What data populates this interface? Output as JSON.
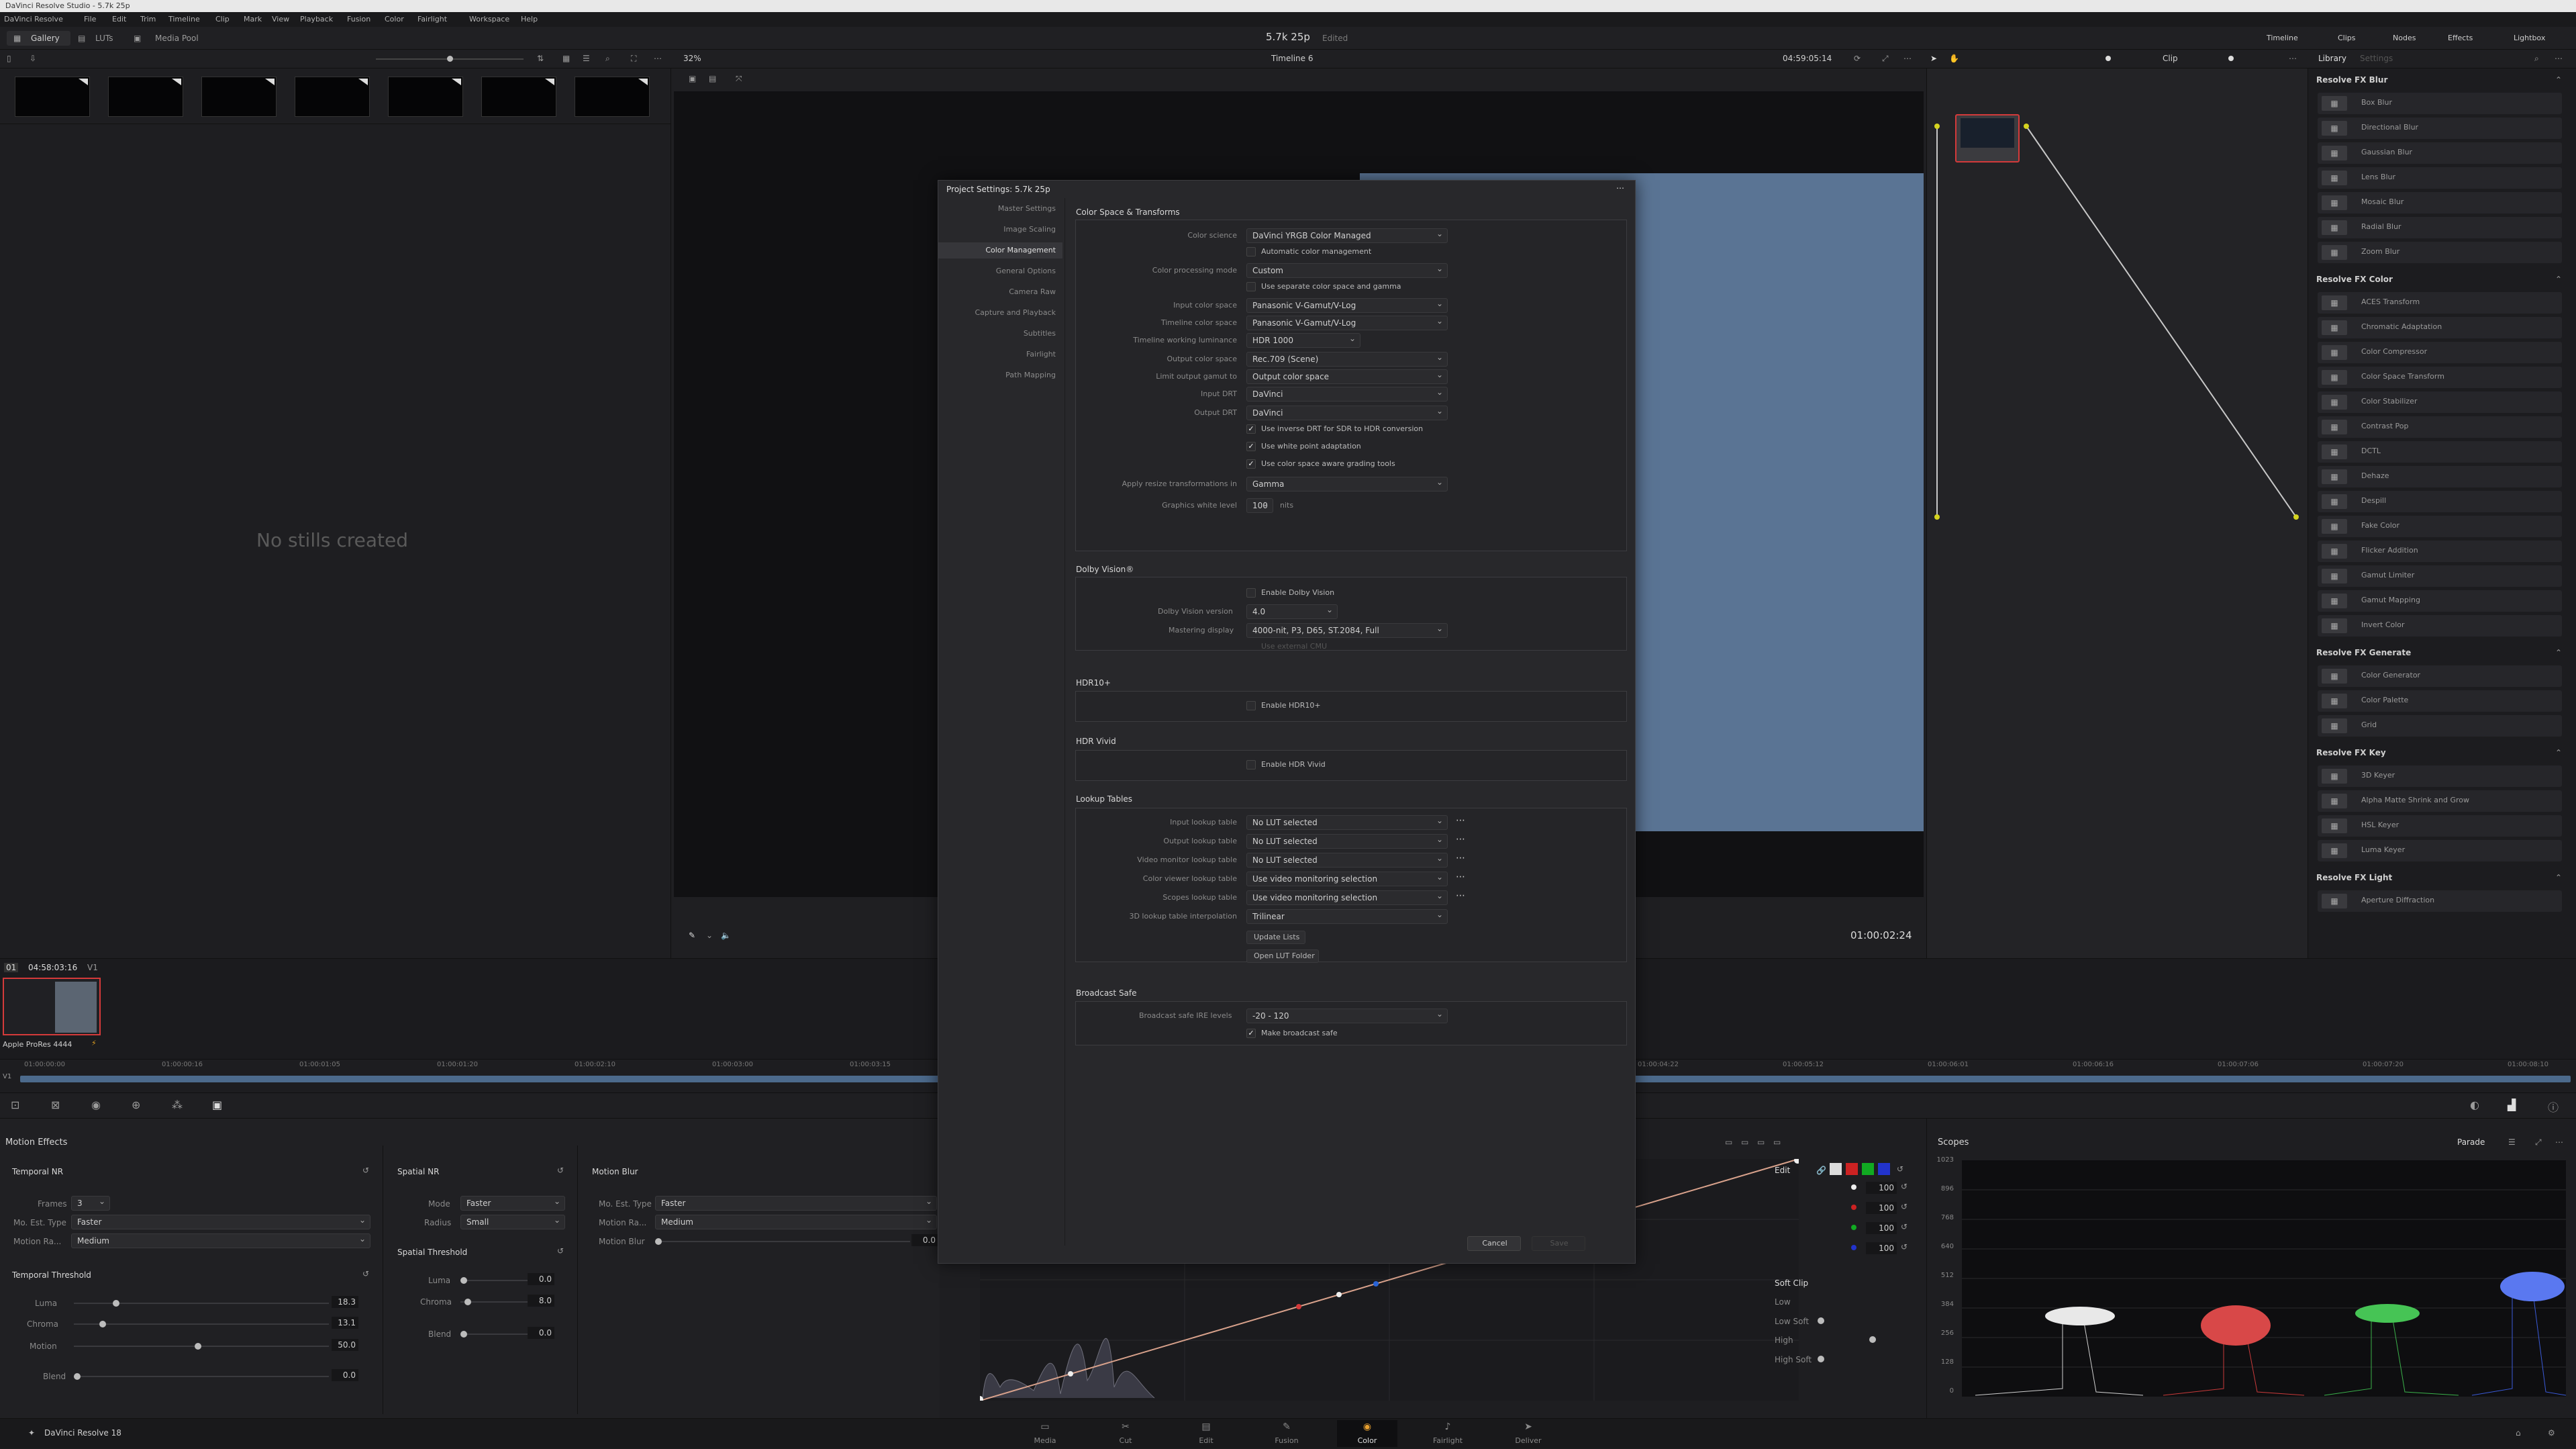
{
  "window_title": "DaVinci Resolve Studio - 5.7k 25p",
  "menu": [
    "DaVinci Resolve",
    "File",
    "Edit",
    "Trim",
    "Timeline",
    "Clip",
    "Mark",
    "View",
    "Playback",
    "Fusion",
    "Color",
    "Fairlight",
    "Workspace",
    "Help"
  ],
  "top": {
    "gallery": "Gallery",
    "luts": "LUTs",
    "media_pool": "Media Pool",
    "project_name": "5.7k 25p",
    "project_status": "Edited",
    "right_tabs": [
      "Timeline",
      "Clips",
      "Nodes",
      "Effects",
      "Lightbox"
    ]
  },
  "viewer_bar": {
    "zoom": "32%",
    "timeline": "Timeline 6",
    "timecode": "04:59:05:14",
    "clip_mode": "Clip",
    "library_tab": "Library",
    "settings_tab": "Settings"
  },
  "gallery": {
    "empty_text": "No stills created"
  },
  "viewer": {
    "timecode": "01:00:02:24"
  },
  "clips": {
    "index": "01",
    "timecode": "04:58:03:16",
    "track": "V1",
    "codec": "Apple ProRes 4444"
  },
  "ruler_labels": [
    "01:00:00:00",
    "01:00:00:16",
    "01:00:01:05",
    "01:00:01:20",
    "01:00:02:10",
    "01:00:03:00",
    "01:00:03:15"
  ],
  "ruler_labels_right": [
    "01:00:04:22",
    "01:00:05:12",
    "01:00:06:01",
    "01:00:06:16",
    "01:00:07:06",
    "01:00:07:20",
    "01:00:08:10"
  ],
  "dialog": {
    "title": "Project Settings:  5.7k 25p",
    "sidebar": [
      "Master Settings",
      "Image Scaling",
      "Color Management",
      "General Options",
      "Camera Raw",
      "Capture and Playback",
      "Subtitles",
      "Fairlight",
      "Path Mapping"
    ],
    "active_index": 2,
    "section_csm": "Color Space & Transforms",
    "rows": [
      {
        "label": "Color science",
        "value": "DaVinci YRGB Color Managed"
      },
      {
        "label": "",
        "check": "Automatic color management",
        "checked": false
      },
      {
        "label": "Color processing mode",
        "value": "Custom"
      },
      {
        "label": "",
        "check": "Use separate color space and gamma",
        "checked": false
      },
      {
        "label": "Input color space",
        "value": "Panasonic V-Gamut/V-Log"
      },
      {
        "label": "Timeline color space",
        "value": "Panasonic V-Gamut/V-Log"
      },
      {
        "label": "Timeline working luminance",
        "value": "HDR 1000"
      },
      {
        "label": "Output color space",
        "value": "Rec.709 (Scene)"
      },
      {
        "label": "Limit output gamut to",
        "value": "Output color space"
      },
      {
        "label": "Input DRT",
        "value": "DaVinci"
      },
      {
        "label": "Output DRT",
        "value": "DaVinci"
      },
      {
        "label": "",
        "check": "Use inverse DRT for SDR to HDR conversion",
        "checked": true
      },
      {
        "label": "",
        "check": "Use white point adaptation",
        "checked": true
      },
      {
        "label": "",
        "check": "Use color space aware grading tools",
        "checked": true
      },
      {
        "label": "Apply resize transformations in",
        "value": "Gamma"
      },
      {
        "label": "Graphics white level",
        "value": "100",
        "unit": "nits"
      }
    ],
    "dolby": {
      "title": "Dolby Vision®",
      "enable": "Enable Dolby Vision",
      "version_label": "Dolby Vision version",
      "version": "4.0",
      "mastering_label": "Mastering display",
      "mastering": "4000-nit, P3, D65, ST.2084, Full",
      "external": "Use external CMU"
    },
    "hdr10": {
      "title": "HDR10+",
      "enable": "Enable HDR10+"
    },
    "hdrvivid": {
      "title": "HDR Vivid",
      "enable": "Enable HDR Vivid"
    },
    "luts": {
      "title": "Lookup Tables",
      "rows": [
        {
          "label": "Input lookup table",
          "value": "No LUT selected"
        },
        {
          "label": "Output lookup table",
          "value": "No LUT selected"
        },
        {
          "label": "Video monitor lookup table",
          "value": "No LUT selected"
        },
        {
          "label": "Color viewer lookup table",
          "value": "Use video monitoring selection"
        },
        {
          "label": "Scopes lookup table",
          "value": "Use video monitoring selection"
        },
        {
          "label": "3D lookup table interpolation",
          "value": "Trilinear"
        }
      ],
      "update": "Update Lists",
      "open": "Open LUT Folder"
    },
    "broadcast": {
      "title": "Broadcast Safe",
      "label": "Broadcast safe IRE levels",
      "value": "-20 - 120",
      "check": "Make broadcast safe"
    },
    "cancel": "Cancel",
    "save": "Save"
  },
  "fx": {
    "groups": [
      {
        "title": "Resolve FX Blur",
        "items": [
          "Box Blur",
          "Directional Blur",
          "Gaussian Blur",
          "Lens Blur",
          "Mosaic Blur",
          "Radial Blur",
          "Zoom Blur"
        ]
      },
      {
        "title": "Resolve FX Color",
        "items": [
          "ACES Transform",
          "Chromatic Adaptation",
          "Color Compressor",
          "Color Space Transform",
          "Color Stabilizer",
          "Contrast Pop",
          "DCTL",
          "Dehaze",
          "Despill",
          "Fake Color",
          "Flicker Addition",
          "Gamut Limiter",
          "Gamut Mapping",
          "Invert Color"
        ]
      },
      {
        "title": "Resolve FX Generate",
        "items": [
          "Color Generator",
          "Color Palette",
          "Grid"
        ]
      },
      {
        "title": "Resolve FX Key",
        "items": [
          "3D Keyer",
          "Alpha Matte Shrink and Grow",
          "HSL Keyer",
          "Luma Keyer"
        ]
      },
      {
        "title": "Resolve FX Light",
        "items": [
          "Aperture Diffraction"
        ]
      }
    ]
  },
  "motion": {
    "title": "Motion Effects",
    "temporal_nr": "Temporal NR",
    "frames_label": "Frames",
    "frames": "3",
    "mo_est_label": "Mo. Est. Type",
    "mo_est": "Faster",
    "motion_range_label": "Motion Ra...",
    "motion_range": "Medium",
    "temporal_threshold": "Temporal Threshold",
    "luma_label": "Luma",
    "luma": "18.3",
    "chroma_label": "Chroma",
    "chroma": "13.1",
    "motion_label": "Motion",
    "motion_val": "50.0",
    "blend_label": "Blend",
    "blend": "0.0",
    "spatial_nr": "Spatial NR",
    "mode_label": "Mode",
    "mode": "Faster",
    "radius_label": "Radius",
    "radius": "Small",
    "spatial_threshold": "Spatial Threshold",
    "s_luma": "0.0",
    "s_chroma": "8.0",
    "s_blend": "0.0",
    "motion_blur": "Motion Blur",
    "mb_type": "Faster",
    "mb_range": "Medium",
    "mb_label": "Motion Blur",
    "mb_val": "0.0"
  },
  "curves": {
    "edit": "Edit",
    "values": [
      "100",
      "100",
      "100",
      "100"
    ],
    "soft_clip": "Soft Clip",
    "low": "Low",
    "low_soft": "Low Soft",
    "high": "High",
    "high_soft": "High Soft"
  },
  "scopes": {
    "title": "Scopes",
    "mode": "Parade",
    "ticks": [
      "1023",
      "896",
      "768",
      "640",
      "512",
      "384",
      "256",
      "128",
      "0"
    ]
  },
  "pages": [
    "Media",
    "Cut",
    "Edit",
    "Fusion",
    "Color",
    "Fairlight",
    "Deliver"
  ],
  "active_page": "Color",
  "brand": "DaVinci Resolve 18"
}
